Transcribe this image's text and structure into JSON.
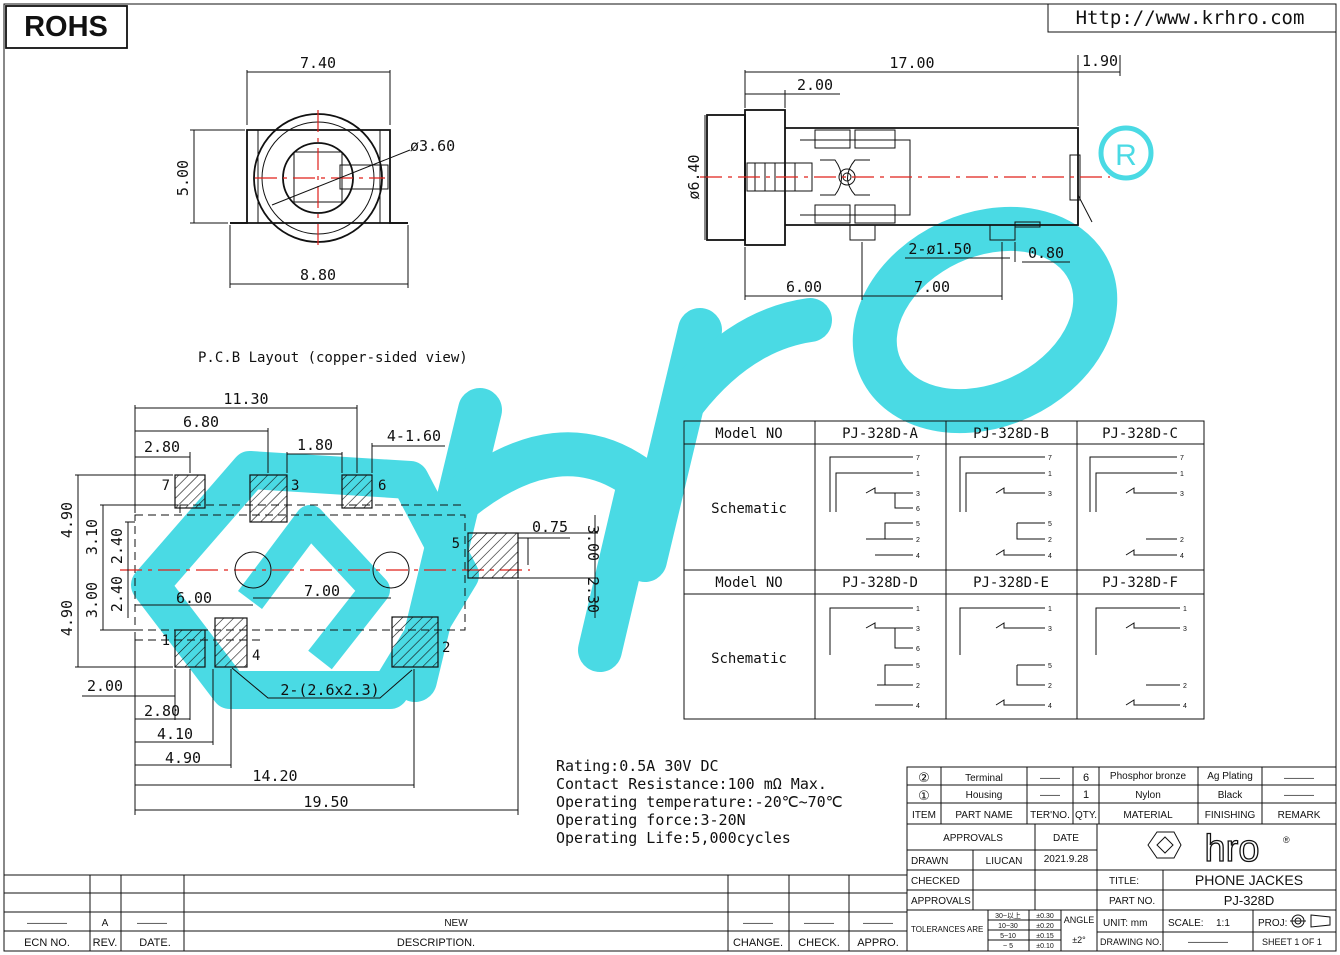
{
  "header": {
    "rohs": "ROHS",
    "url": "Http://www.krhro.com"
  },
  "front_view": {
    "width_top": "7.40",
    "height": "5.00",
    "hole_dia": "ø3.60",
    "width_bottom": "8.80"
  },
  "side_view": {
    "length": "17.00",
    "tip": "1.90",
    "front_len": "2.00",
    "dia": "ø6.40",
    "pin_holes": "2-ø1.50",
    "pin_w": "0.80",
    "pos1": "6.00",
    "pos2": "7.00"
  },
  "pcb": {
    "title": "P.C.B Layout (copper-sided view)",
    "dims": {
      "d1130": "11.30",
      "d680": "6.80",
      "d280a": "2.80",
      "d180": "1.80",
      "d4160": "4-1.60",
      "d490a": "4.90",
      "d310": "3.10",
      "d240a": "2.40",
      "d075": "0.75",
      "d300a": "3.00",
      "d600": "6.00",
      "d700": "7.00",
      "d300b": "3.00",
      "d240b": "2.40",
      "d230": "2.30",
      "d490b": "4.90",
      "d200": "2.00",
      "d280b": "2.80",
      "d410": "4.10",
      "d490c": "4.90",
      "d1420": "14.20",
      "d1950": "19.50",
      "slot": "2-(2.6x2.3)"
    },
    "pins": [
      "7",
      "3",
      "6",
      "5",
      "1",
      "4",
      "2"
    ]
  },
  "specs": [
    "Rating:0.5A 30V DC",
    "Contact Resistance:100 mΩ Max.",
    "Operating temperature:-20℃~70℃",
    "Operating force:3-20N",
    "Operating Life:5,000cycles"
  ],
  "model_table": {
    "head1": [
      "Model NO",
      "PJ-328D-A",
      "PJ-328D-B",
      "PJ-328D-C"
    ],
    "head2": [
      "Model NO",
      "PJ-328D-D",
      "PJ-328D-E",
      "PJ-328D-F"
    ],
    "row_label": "Schematic"
  },
  "bom": {
    "rows": [
      {
        "no": "②",
        "part": "Terminal",
        "ter": "——",
        "qty": "6",
        "material": "Phosphor bronze",
        "finish": "Ag Plating",
        "remark": "———"
      },
      {
        "no": "①",
        "part": "Housing",
        "ter": "——",
        "qty": "1",
        "material": "Nylon",
        "finish": "Black",
        "remark": "———"
      }
    ],
    "headers": [
      "ITEM",
      "PART NAME",
      "TER'NO.",
      "QTY.",
      "MATERIAL",
      "FINISHING",
      "REMARK"
    ]
  },
  "title_block": {
    "approvals": "APPROVALS",
    "date": "DATE",
    "drawn": "DRAWN",
    "drawn_by": "LIUCAN",
    "drawn_date": "2021.9.28",
    "checked": "CHECKED",
    "approvals2": "APPROVALS",
    "title_label": "TITLE:",
    "title": "PHONE JACKES",
    "part_label": "PART NO.",
    "part_no": "PJ-328D",
    "tolerances": "TOLERANCES ARE",
    "tol_ranges": [
      "30~以上",
      "10~30",
      "5~10",
      "~ 5"
    ],
    "tol_vals": [
      "±0.30",
      "±0.20",
      "±0.15",
      "±0.10"
    ],
    "angle": "ANGLE",
    "angle_val": "±2°",
    "unit": "UNIT: mm",
    "scale": "SCALE:",
    "scale_val": "1:1",
    "proj": "PROJ:",
    "drawing_no": "DRAWING NO.",
    "drawing_no_val": "————",
    "sheet": "SHEET 1 OF 1",
    "logo": "hro"
  },
  "revision": {
    "headers": [
      "ECN NO.",
      "REV.",
      "DATE.",
      "DESCRIPTION.",
      "CHANGE.",
      "CHECK.",
      "APPRO."
    ],
    "row": [
      "————",
      "A",
      "———",
      "NEW",
      "———",
      "———",
      "———"
    ]
  },
  "colors": {
    "watermark": "#2ad4e0",
    "centerline": "#e0201a"
  }
}
